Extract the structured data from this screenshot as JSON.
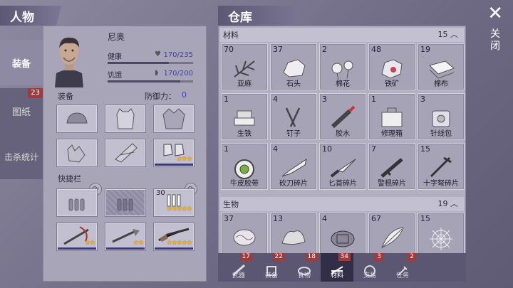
{
  "header": {
    "character_title": "人物",
    "storage_title": "仓库",
    "close_label": "关闭"
  },
  "side_tabs": [
    {
      "label": "装备",
      "active": true
    },
    {
      "label": "图纸",
      "badge": "23"
    },
    {
      "label": "击杀统计"
    }
  ],
  "character": {
    "name": "尼奥",
    "health_label": "健康",
    "health_value": "170/235",
    "health_fraction": 0.72,
    "hunger_label": "饥饿",
    "hunger_value": "170/200",
    "hunger_fraction": 0.85,
    "equipment_label": "装备",
    "defense_label": "防御力：",
    "defense_value": "0",
    "quickbar_label": "快捷栏",
    "equip_slots": [
      "hat-icon",
      "vest-icon",
      "jacket-icon",
      "gloves-icon",
      "pants-icon",
      "boots-icon"
    ],
    "boots_stars": "★★★",
    "quick_slots": [
      {
        "icon": "bullets-icon"
      },
      {
        "icon": "bullets-icon",
        "dark": true
      },
      {
        "icon": "bolts-icon",
        "count": "30",
        "stars": "★★★★★"
      },
      {
        "icon": "crossbow-icon",
        "stars": "★★"
      },
      {
        "icon": "spear-icon",
        "stars": "★★"
      },
      {
        "icon": "shotgun-icon",
        "stars": "★★★★★"
      }
    ]
  },
  "storage": {
    "materials_label": "材料",
    "materials_count": "15",
    "materials": [
      {
        "q": "70",
        "name": "亚麻",
        "icon": "flax-icon"
      },
      {
        "q": "37",
        "name": "石头",
        "icon": "stone-icon"
      },
      {
        "q": "2",
        "name": "棉花",
        "icon": "cotton-icon"
      },
      {
        "q": "48",
        "name": "铁矿",
        "icon": "iron-ore-icon"
      },
      {
        "q": "19",
        "name": "棉布",
        "icon": "cloth-icon"
      },
      {
        "q": "1",
        "name": "生铁",
        "icon": "pig-iron-icon"
      },
      {
        "q": "4",
        "name": "钉子",
        "icon": "nails-icon"
      },
      {
        "q": "3",
        "name": "胶水",
        "icon": "glue-icon"
      },
      {
        "q": "1",
        "name": "修理箱",
        "icon": "repair-kit-icon"
      },
      {
        "q": "3",
        "name": "针线包",
        "icon": "sewing-kit-icon"
      },
      {
        "q": "1",
        "name": "牛皮胶带",
        "icon": "tape-icon"
      },
      {
        "q": "4",
        "name": "砍刀碎片",
        "icon": "machete-icon"
      },
      {
        "q": "10",
        "name": "匕首碎片",
        "icon": "dagger-icon"
      },
      {
        "q": "7",
        "name": "警棍碎片",
        "icon": "baton-icon"
      },
      {
        "q": "15",
        "name": "十字弩碎片",
        "icon": "crossbow-part-icon"
      }
    ],
    "creatures_label": "生物",
    "creatures_count": "19",
    "creatures": [
      {
        "q": "37",
        "icon": "brain-icon"
      },
      {
        "q": "13",
        "icon": "fur-icon"
      },
      {
        "q": "4",
        "icon": "turtle-shell-icon"
      },
      {
        "q": "67",
        "icon": "feather-icon"
      },
      {
        "q": "15",
        "icon": "spider-web-icon"
      }
    ]
  },
  "bottom_tabs": [
    {
      "label": "武器",
      "badge": "17",
      "icon": "weapon-icon"
    },
    {
      "label": "装备",
      "badge": "22",
      "icon": "gear-icon"
    },
    {
      "label": "食物",
      "badge": "18",
      "icon": "food-icon"
    },
    {
      "label": "材料",
      "badge": "34",
      "icon": "materials-icon",
      "active": true
    },
    {
      "label": "交易",
      "badge": "3",
      "icon": "trade-icon"
    },
    {
      "label": "任务",
      "badge": "2",
      "icon": "quest-icon"
    }
  ]
}
